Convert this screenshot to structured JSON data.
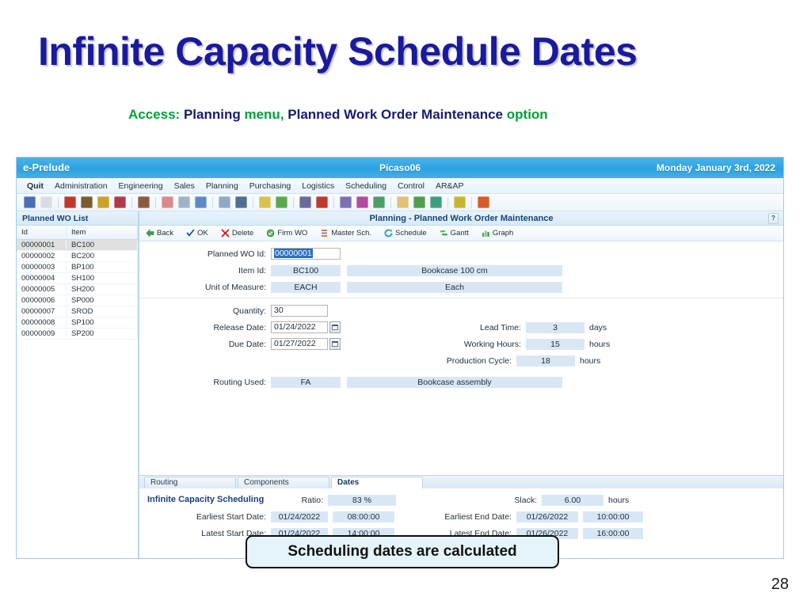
{
  "slide": {
    "title": "Infinite Capacity Schedule Dates",
    "subtitle": {
      "access_label": "Access:",
      "menu_name": "Planning",
      "menu_word": "menu,",
      "option_name": "Planned Work Order Maintenance",
      "option_word": "option"
    },
    "page_number": "28",
    "callout": "Scheduling dates are calculated"
  },
  "app": {
    "brand": "e-Prelude",
    "user": "Picaso06",
    "date": "Monday January 3rd, 2022",
    "menu": [
      "Quit",
      "Administration",
      "Engineering",
      "Sales",
      "Planning",
      "Purchasing",
      "Logistics",
      "Scheduling",
      "Control",
      "AR&AP"
    ],
    "toolbar_icons": [
      {
        "name": "save-icon",
        "color": "#4a6fb5"
      },
      {
        "name": "print-icon",
        "color": "#d8dde3"
      },
      {
        "name": "customers-icon",
        "color": "#c0392b"
      },
      {
        "name": "products-icon",
        "color": "#7a5c2e"
      },
      {
        "name": "folder-icon",
        "color": "#c9a227"
      },
      {
        "name": "network-icon",
        "color": "#b03a4a"
      },
      {
        "name": "bom-icon",
        "color": "#8c5a3c"
      },
      {
        "name": "gear-icon",
        "color": "#d98a8a"
      },
      {
        "name": "grid-icon",
        "color": "#9fb3c8"
      },
      {
        "name": "chart-icon",
        "color": "#5b8ac6"
      },
      {
        "name": "calendar-icon",
        "color": "#8fa9c4"
      },
      {
        "name": "clock-icon",
        "color": "#4c6f94"
      },
      {
        "name": "notes-icon",
        "color": "#d9c24a"
      },
      {
        "name": "stock-icon",
        "color": "#5aa84f"
      },
      {
        "name": "orders-icon",
        "color": "#6a6a9c"
      },
      {
        "name": "schedule-icon",
        "color": "#c0392b"
      },
      {
        "name": "cycle-icon",
        "color": "#7d6fb0"
      },
      {
        "name": "edit-icon",
        "color": "#b44b9e"
      },
      {
        "name": "ball-icon",
        "color": "#4f9e6a"
      },
      {
        "name": "house-icon",
        "color": "#e2c177"
      },
      {
        "name": "people-icon",
        "color": "#4f9e4f"
      },
      {
        "name": "key-icon",
        "color": "#3f9e7a"
      },
      {
        "name": "help-icon",
        "color": "#c9b432"
      },
      {
        "name": "up-arrow-icon",
        "color": "#d85a2a"
      }
    ]
  },
  "sidebar": {
    "header": "Planned WO List",
    "columns": [
      "Id",
      "Item"
    ],
    "rows": [
      {
        "id": "00000001",
        "item": "BC100",
        "selected": true
      },
      {
        "id": "00000002",
        "item": "BC200",
        "selected": false
      },
      {
        "id": "00000003",
        "item": "BP100",
        "selected": false
      },
      {
        "id": "00000004",
        "item": "SH100",
        "selected": false
      },
      {
        "id": "00000005",
        "item": "SH200",
        "selected": false
      },
      {
        "id": "00000006",
        "item": "SP000",
        "selected": false
      },
      {
        "id": "00000007",
        "item": "SROD",
        "selected": false
      },
      {
        "id": "00000008",
        "item": "SP100",
        "selected": false
      },
      {
        "id": "00000009",
        "item": "SP200",
        "selected": false
      }
    ]
  },
  "panel": {
    "title": "Planning - Planned Work Order Maintenance",
    "help_glyph": "?",
    "toolbar": [
      {
        "label": "Back",
        "icon": "back-arrow-icon"
      },
      {
        "label": "OK",
        "icon": "check-icon"
      },
      {
        "label": "Delete",
        "icon": "delete-x-icon"
      },
      {
        "label": "Firm WO",
        "icon": "firm-wo-icon"
      },
      {
        "label": "Master Sch.",
        "icon": "master-schedule-icon"
      },
      {
        "label": "Schedule",
        "icon": "schedule-refresh-icon"
      },
      {
        "label": "Gantt",
        "icon": "gantt-icon"
      },
      {
        "label": "Graph",
        "icon": "graph-icon"
      }
    ]
  },
  "form": {
    "planned_wo_id_label": "Planned WO Id:",
    "planned_wo_id_value": "00000001",
    "item_id_label": "Item Id:",
    "item_id_value": "BC100",
    "item_desc": "Bookcase 100 cm",
    "uom_label": "Unit of Measure:",
    "uom_value": "EACH",
    "uom_desc": "Each",
    "quantity_label": "Quantity:",
    "quantity_value": "30",
    "release_date_label": "Release Date:",
    "release_date_value": "01/24/2022",
    "due_date_label": "Due Date:",
    "due_date_value": "01/27/2022",
    "routing_used_label": "Routing Used:",
    "routing_used_value": "FA",
    "routing_desc": "Bookcase assembly",
    "lead_time_label": "Lead Time:",
    "lead_time_value": "3",
    "lead_time_unit": "days",
    "working_hours_label": "Working Hours:",
    "working_hours_value": "15",
    "working_hours_unit": "hours",
    "production_cycle_label": "Production Cycle:",
    "production_cycle_value": "18",
    "production_cycle_unit": "hours"
  },
  "tabs": [
    {
      "label": "Routing",
      "active": false
    },
    {
      "label": "Components",
      "active": false
    },
    {
      "label": "Dates",
      "active": true
    }
  ],
  "scheduling": {
    "title": "Infinite Capacity Scheduling",
    "ratio_label": "Ratio:",
    "ratio_value": "83 %",
    "slack_label": "Slack:",
    "slack_value": "6.00",
    "slack_unit": "hours",
    "earliest_start_label": "Earliest Start Date:",
    "earliest_start_date": "01/24/2022",
    "earliest_start_time": "08:00:00",
    "latest_start_label": "Latest Start Date:",
    "latest_start_date": "01/24/2022",
    "latest_start_time": "14:00:00",
    "earliest_end_label": "Earliest End Date:",
    "earliest_end_date": "01/26/2022",
    "earliest_end_time": "10:00:00",
    "latest_end_label": "Latest End Date:",
    "latest_end_date": "01/26/2022",
    "latest_end_time": "16:00:00"
  },
  "colors": {
    "title_blue": "#1a1a9e",
    "accent_green": "#00a13a",
    "titlebar_blue": "#2ba3e3",
    "readonly_field": "#d9e7f5",
    "selection_blue": "#2b6fc2",
    "callout_bg": "#e4f4fa"
  }
}
